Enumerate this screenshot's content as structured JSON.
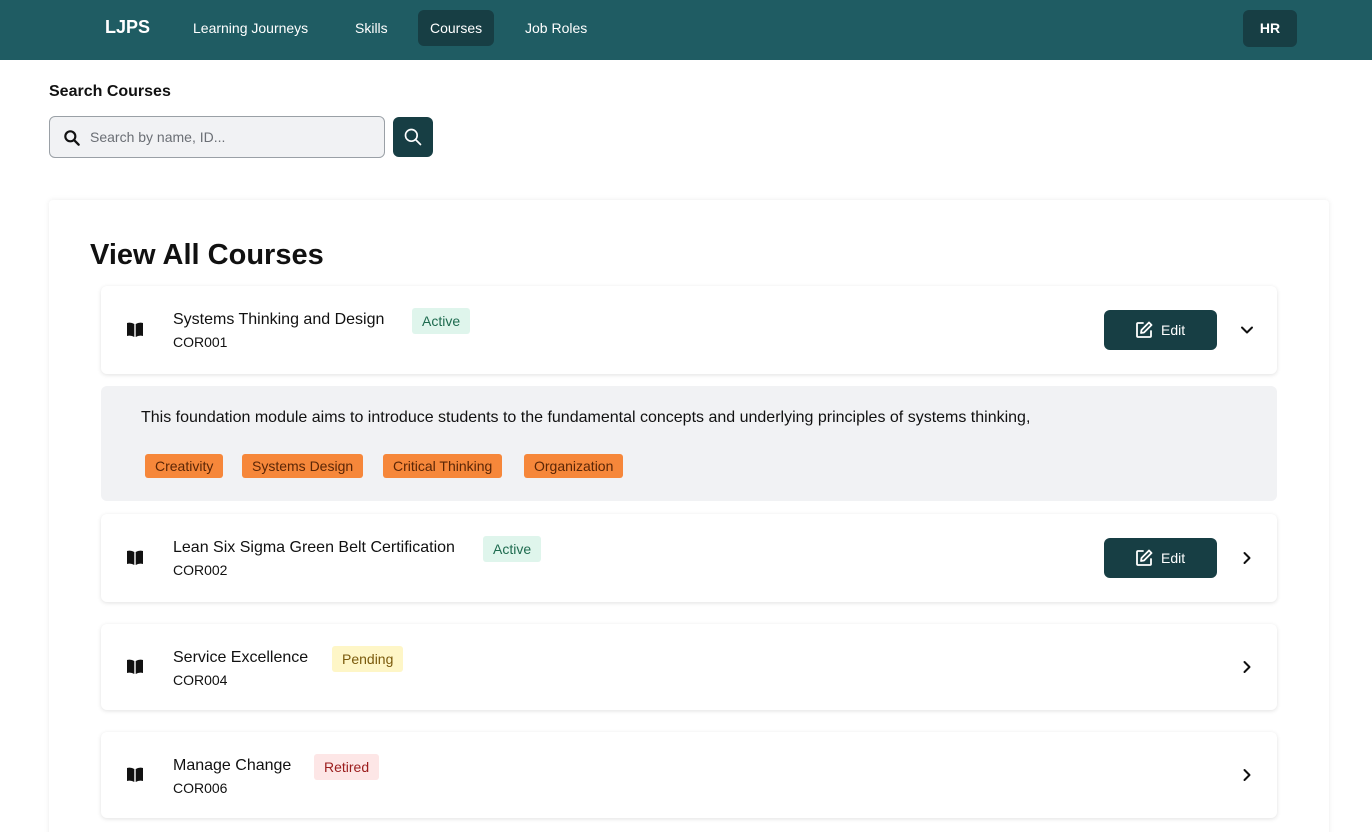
{
  "nav": {
    "brand": "LJPS",
    "items": [
      {
        "label": "Learning Journeys",
        "active": false
      },
      {
        "label": "Skills",
        "active": false
      },
      {
        "label": "Courses",
        "active": true
      },
      {
        "label": "Job Roles",
        "active": false
      }
    ],
    "role": "HR"
  },
  "search": {
    "label": "Search Courses",
    "placeholder": "Search by name, ID...",
    "value": ""
  },
  "main": {
    "title": "View All Courses",
    "edit_label": "Edit",
    "courses": [
      {
        "name": "Systems Thinking and Design",
        "id": "COR001",
        "status": "Active",
        "expanded": true,
        "editable": true
      },
      {
        "name": "Lean Six Sigma Green Belt Certification",
        "id": "COR002",
        "status": "Active",
        "expanded": false,
        "editable": true
      },
      {
        "name": "Service Excellence",
        "id": "COR004",
        "status": "Pending",
        "expanded": false,
        "editable": false
      },
      {
        "name": "Manage Change",
        "id": "COR006",
        "status": "Retired",
        "expanded": false,
        "editable": false
      }
    ],
    "expanded_detail": {
      "description": "This foundation module aims to introduce students to the fundamental concepts and underlying principles of systems thinking,",
      "skills": [
        "Creativity",
        "Systems Design",
        "Critical Thinking",
        "Organization"
      ]
    }
  },
  "colors": {
    "header_bg": "#1f5c63",
    "accent_dark": "#173e44",
    "tag_bg": "#f6873a",
    "active_badge_bg": "#dff5ec",
    "pending_badge_bg": "#fef6c7",
    "retired_badge_bg": "#fde6e6"
  },
  "icons": {
    "search": "search-icon",
    "course": "book-open-icon",
    "edit": "edit-icon",
    "expanded": "chevron-down-icon",
    "collapsed": "chevron-right-icon"
  }
}
